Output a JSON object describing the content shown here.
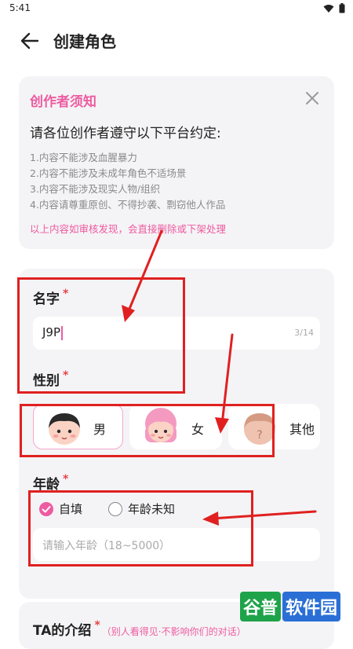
{
  "status": {
    "time": "5:41"
  },
  "header": {
    "title": "创建角色"
  },
  "notice": {
    "title": "创作者须知",
    "heading": "请各位创作者遵守以下平台约定:",
    "rules": [
      "1.内容不能涉及血腥暴力",
      "2.内容不能涉及未成年角色不适场景",
      "3.内容不能涉及现实人物/组织",
      "4.内容请尊重原创、不得抄袭、剽窃他人作品"
    ],
    "warning": "以上内容如审核发现，会直接删除或下架处理"
  },
  "form": {
    "name": {
      "label": "名字",
      "required": "*",
      "value": "J9P",
      "counter": "3/14"
    },
    "gender": {
      "label": "性别",
      "required": "*",
      "options": [
        {
          "label": "男",
          "selected": true
        },
        {
          "label": "女",
          "selected": false
        },
        {
          "label": "其他",
          "selected": false
        }
      ]
    },
    "age": {
      "label": "年龄",
      "required": "*",
      "options": [
        {
          "label": "自填",
          "checked": true
        },
        {
          "label": "年龄未知",
          "checked": false
        }
      ],
      "placeholder": "请输入年龄（18~5000）"
    },
    "intro": {
      "label": "TA的介绍",
      "required": "*",
      "hint": "（别人看得见·不影响你们的对话）"
    }
  },
  "watermark": {
    "part1": "谷普",
    "part2": "软件园"
  },
  "colors": {
    "accent": "#ee5ba0",
    "required": "#e64545",
    "annotation": "#e02020",
    "card_bg": "#f4f4f6"
  },
  "icons": {
    "back": "arrow-left-icon",
    "close": "close-icon",
    "avatars": [
      "boy-avatar-icon",
      "girl-avatar-icon",
      "unknown-avatar-icon"
    ]
  }
}
